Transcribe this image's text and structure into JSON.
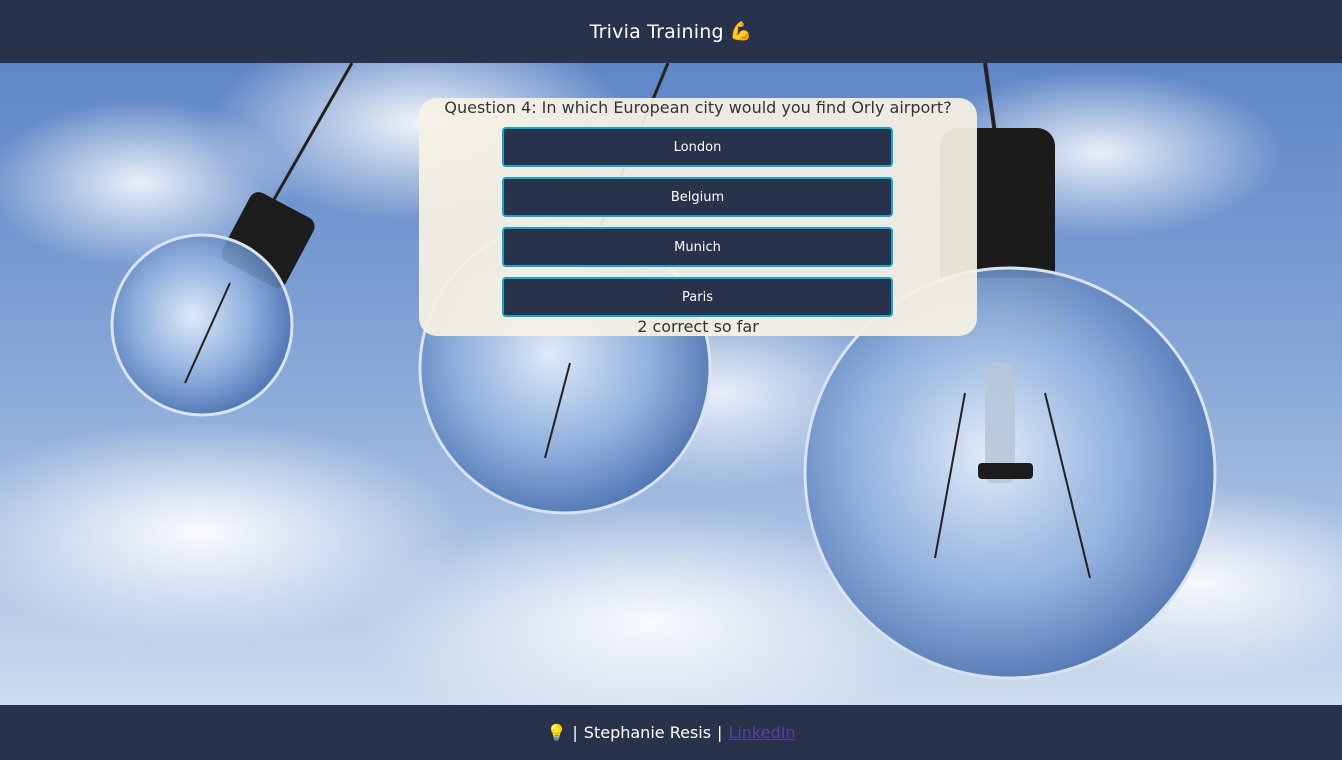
{
  "header": {
    "title": "Trivia Training",
    "emoji": "💪"
  },
  "quiz": {
    "question": "Question 4: In which European city would you find Orly airport?",
    "answers": [
      "London",
      "Belgium",
      "Munich",
      "Paris"
    ],
    "score_text": "2 correct so far"
  },
  "footer": {
    "bulb": "💡",
    "separator_left": "|",
    "author": "Stephanie Resis",
    "separator_right": "|",
    "link_label": "LinkedIn"
  },
  "colors": {
    "navy": "#28324a",
    "button_border": "#1aa4c8",
    "card_bg": "#f6f1e4",
    "link": "#5a3ea8"
  }
}
